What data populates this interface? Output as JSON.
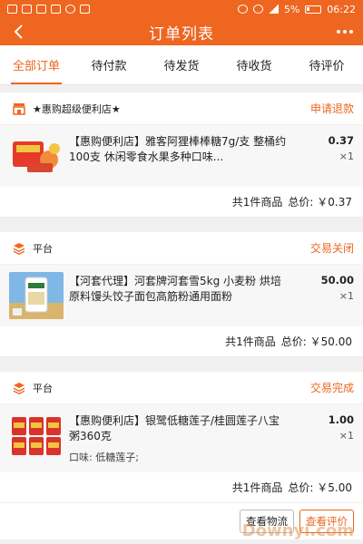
{
  "status_bar": {
    "battery": "5%",
    "time": "06:22"
  },
  "header": {
    "title": "订单列表"
  },
  "tabs": [
    {
      "label": "全部订单",
      "active": true
    },
    {
      "label": "待付款"
    },
    {
      "label": "待发货"
    },
    {
      "label": "待收货"
    },
    {
      "label": "待评价"
    }
  ],
  "orders": [
    {
      "store": "★惠购超级便利店★",
      "status": "申请退款",
      "item": {
        "title": "【惠购便利店】雅客阿狸棒棒糖7g/支 整桶约100支 休闲零食水果多种口味...",
        "price": "0.37",
        "qty": "×1"
      },
      "summary": {
        "count": "共1件商品",
        "total": "总价: ￥0.37"
      }
    },
    {
      "store": "平台",
      "status": "交易关闭",
      "item": {
        "title": "【河套代理】河套牌河套雪5kg 小麦粉 烘培原料馒头饺子面包高筋粉通用面粉",
        "price": "50.00",
        "qty": "×1"
      },
      "summary": {
        "count": "共1件商品",
        "total": "总价: ￥50.00"
      }
    },
    {
      "store": "平台",
      "status": "交易完成",
      "item": {
        "title": "【惠购便利店】银鹭低糖莲子/桂圆莲子八宝粥360克",
        "attr": "口味: 低糖莲子;",
        "price": "1.00",
        "qty": "×1"
      },
      "summary": {
        "count": "共1件商品",
        "total": "总价: ￥5.00"
      },
      "actions": {
        "logistics": "查看物流",
        "review": "查看评价"
      }
    }
  ],
  "watermark": "Downyi.com",
  "colors": {
    "accent": "#ee6620"
  },
  "icons": [
    "back-icon",
    "more-icon",
    "store-icon",
    "platform-icon"
  ]
}
